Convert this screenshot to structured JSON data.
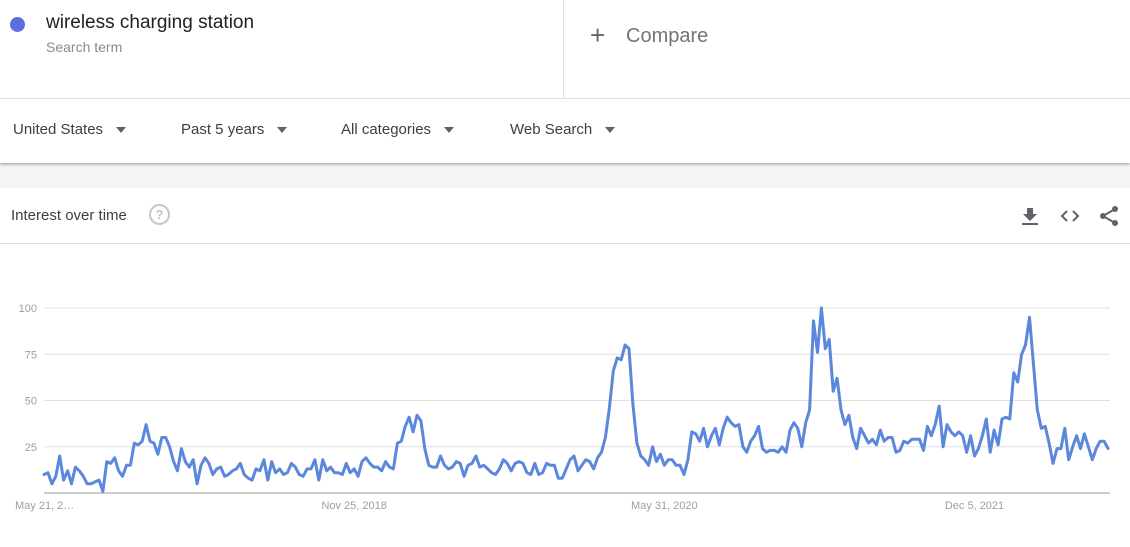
{
  "search_term": {
    "name": "wireless charging station",
    "sublabel": "Search term",
    "color": "#5c6fe0"
  },
  "compare": {
    "icon": "plus-icon",
    "label": "Compare"
  },
  "filters": [
    {
      "label": "United States",
      "icon": "caret-down-icon"
    },
    {
      "label": "Past 5 years",
      "icon": "caret-down-icon"
    },
    {
      "label": "All categories",
      "icon": "caret-down-icon"
    },
    {
      "label": "Web Search",
      "icon": "caret-down-icon"
    }
  ],
  "card": {
    "title": "Interest over time",
    "help_icon": "?",
    "actions": [
      "download-icon",
      "embed-code-icon",
      "share-icon"
    ]
  },
  "chart_data": {
    "type": "line",
    "title": "Interest over time",
    "xlabel": "",
    "ylabel": "",
    "ylim": [
      0,
      100
    ],
    "yticks": [
      25,
      50,
      75,
      100
    ],
    "xtick_labels": [
      "May 21, 2…",
      "Nov 25, 2018",
      "May 31, 2020",
      "Dec 5, 2021"
    ],
    "xtick_positions": [
      0,
      79,
      158,
      237
    ],
    "grid": true,
    "legend": "none",
    "line_color": "#5b87dc",
    "series": [
      {
        "name": "wireless charging station",
        "interval": "weekly",
        "values": [
          10,
          11,
          5,
          9,
          20,
          7,
          12,
          5,
          14,
          12,
          9,
          5,
          5,
          6,
          7,
          1,
          17,
          16,
          19,
          12,
          9,
          15,
          15,
          27,
          26,
          28,
          37,
          28,
          27,
          21,
          30,
          30,
          25,
          17,
          12,
          24,
          17,
          14,
          18,
          5,
          15,
          19,
          16,
          10,
          13,
          14,
          9,
          10,
          12,
          13,
          16,
          10,
          8,
          7,
          13,
          12,
          18,
          7,
          17,
          11,
          13,
          10,
          11,
          16,
          14,
          10,
          9,
          13,
          13,
          18,
          7,
          18,
          12,
          14,
          11,
          11,
          10,
          16,
          11,
          13,
          9,
          17,
          19,
          16,
          14,
          14,
          12,
          17,
          14,
          13,
          27,
          28,
          36,
          41,
          33,
          42,
          39,
          24,
          15,
          14,
          14,
          20,
          15,
          13,
          14,
          17,
          16,
          9,
          15,
          16,
          20,
          14,
          15,
          13,
          11,
          10,
          13,
          18,
          16,
          12,
          16,
          17,
          16,
          11,
          10,
          16,
          10,
          11,
          16,
          15,
          15,
          8,
          8,
          13,
          18,
          20,
          12,
          15,
          18,
          17,
          13,
          19,
          22,
          30,
          46,
          66,
          73,
          72,
          80,
          78,
          48,
          27,
          20,
          18,
          15,
          25,
          17,
          21,
          15,
          18,
          18,
          15,
          15,
          10,
          18,
          33,
          32,
          28,
          35,
          25,
          31,
          35,
          26,
          35,
          41,
          38,
          36,
          37,
          25,
          22,
          28,
          31,
          36,
          24,
          22,
          23,
          23,
          22,
          25,
          22,
          34,
          38,
          35,
          25,
          38,
          45,
          93,
          76,
          100,
          78,
          83,
          55,
          62,
          45,
          37,
          42,
          30,
          24,
          35,
          31,
          27,
          29,
          26,
          34,
          28,
          30,
          30,
          22,
          23,
          28,
          27,
          29,
          29,
          29,
          23,
          36,
          31,
          37,
          47,
          25,
          37,
          33,
          31,
          33,
          31,
          22,
          31,
          20,
          24,
          31,
          40,
          22,
          34,
          26,
          40,
          41,
          40,
          65,
          60,
          75,
          80,
          95,
          70,
          45,
          35,
          36,
          27,
          16,
          24,
          24,
          35,
          18,
          25,
          31,
          24,
          32,
          25,
          18,
          24,
          28,
          28,
          24
        ]
      }
    ]
  }
}
